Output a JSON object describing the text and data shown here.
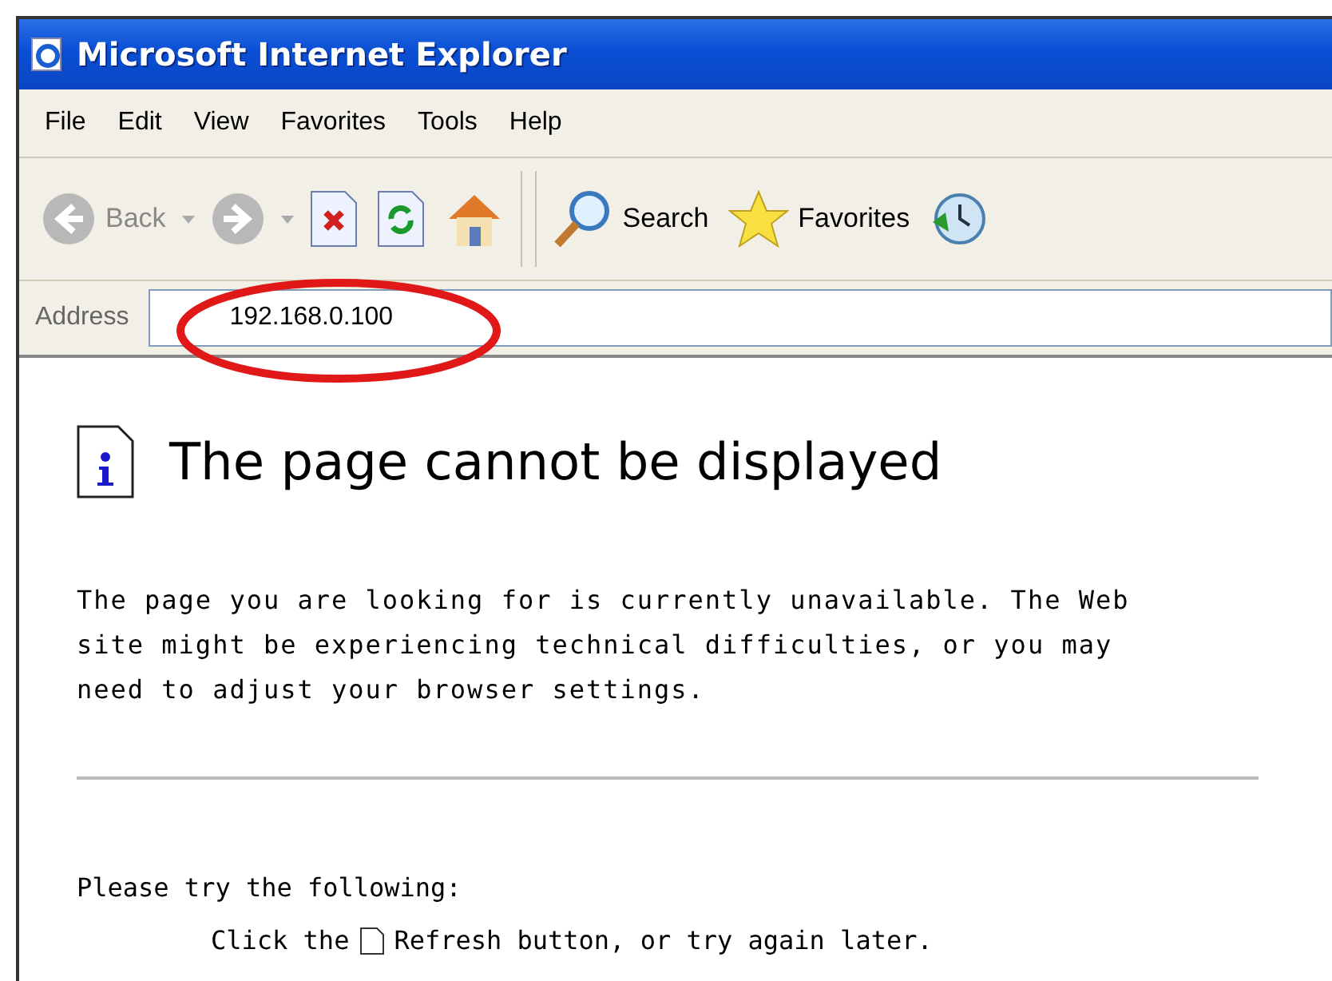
{
  "window": {
    "title": "Microsoft Internet Explorer"
  },
  "menu": [
    "File",
    "Edit",
    "View",
    "Favorites",
    "Tools",
    "Help"
  ],
  "toolbar": [
    {
      "kind": "back",
      "label": "Back",
      "disabled": true
    },
    {
      "kind": "forward",
      "disabled": true
    },
    {
      "kind": "stop"
    },
    {
      "kind": "refresh"
    },
    {
      "kind": "home"
    },
    {
      "kind": "search",
      "label": "Search"
    },
    {
      "kind": "favorites",
      "label": "Favorites"
    },
    {
      "kind": "history"
    }
  ],
  "address": {
    "label": "Address",
    "value": "192.168.0.100"
  },
  "page": {
    "heading": "The page cannot be displayed",
    "paragraph": "The page you are looking for is currently unavailable. The Web site might be experiencing technical difficulties, or you may need to adjust your browser settings.",
    "try_heading": "Please try the following:",
    "bullets": [
      {
        "before": "Click the",
        "after": "Refresh button, or try again later."
      }
    ]
  }
}
